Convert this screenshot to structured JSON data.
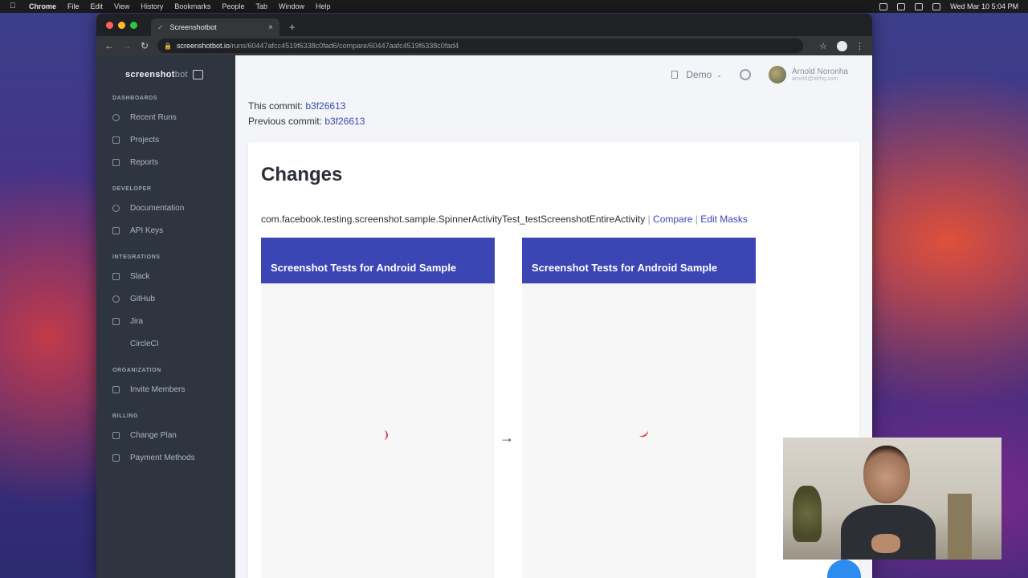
{
  "menubar": {
    "app": "Chrome",
    "items": [
      "File",
      "Edit",
      "View",
      "History",
      "Bookmarks",
      "People",
      "Tab",
      "Window",
      "Help"
    ],
    "clock": "Wed Mar 10  5:04 PM"
  },
  "browser": {
    "tab_title": "Screenshotbot",
    "url_host": "screenshotbot.io",
    "url_path": "/runs/60447afcc4519f6338c0fad6/compare/60447aafc4519f6338c0fad4"
  },
  "sidebar": {
    "logo_main": "screenshot",
    "logo_accent": "bot",
    "sections": [
      {
        "heading": "DASHBOARDS",
        "items": [
          {
            "label": "Recent Runs",
            "icon": "clock-icon"
          },
          {
            "label": "Projects",
            "icon": "book-icon"
          },
          {
            "label": "Reports",
            "icon": "report-icon"
          }
        ]
      },
      {
        "heading": "DEVELOPER",
        "items": [
          {
            "label": "Documentation",
            "icon": "bulb-icon"
          },
          {
            "label": "API Keys",
            "icon": "key-icon"
          }
        ]
      },
      {
        "heading": "INTEGRATIONS",
        "items": [
          {
            "label": "Slack",
            "icon": "slack-icon"
          },
          {
            "label": "GitHub",
            "icon": "github-icon"
          },
          {
            "label": "Jira",
            "icon": "jira-icon"
          },
          {
            "label": "CircleCI",
            "icon": "circleci-icon"
          }
        ]
      },
      {
        "heading": "ORGANIZATION",
        "items": [
          {
            "label": "Invite Members",
            "icon": "user-add-icon"
          }
        ]
      },
      {
        "heading": "BILLING",
        "items": [
          {
            "label": "Change Plan",
            "icon": "calendar-icon"
          },
          {
            "label": "Payment Methods",
            "icon": "card-icon"
          }
        ]
      }
    ]
  },
  "header": {
    "company": "Demo",
    "user_name": "Arnold Noronha",
    "user_email": "arnold@tdrhq.com"
  },
  "commits": {
    "this_label": "This commit:",
    "this_hash": "b3f26613",
    "prev_label": "Previous commit:",
    "prev_hash": "b3f26613"
  },
  "changes": {
    "title": "Changes",
    "test_name": "com.facebook.testing.screenshot.sample.SpinnerActivityTest_testScreenshotEntireActivity",
    "separator": "|",
    "compare_label": "Compare",
    "edit_masks_label": "Edit Masks",
    "before_appbar": "Screenshot Tests for Android Sample",
    "after_appbar": "Screenshot Tests for Android Sample",
    "arrow": "→"
  },
  "colors": {
    "sidebar_bg": "#2f3540",
    "accent": "#3c45b4",
    "link": "#3b47b0",
    "spinner": "#e2394f"
  }
}
